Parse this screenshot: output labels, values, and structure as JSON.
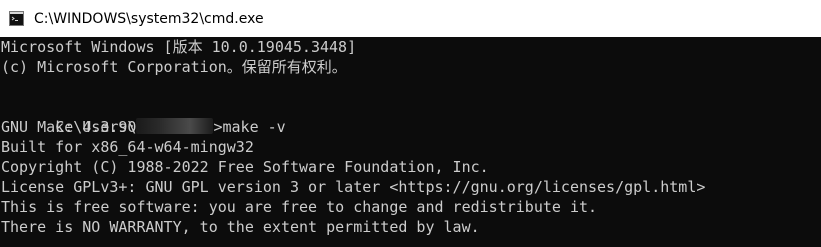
{
  "window": {
    "title": "C:\\WINDOWS\\system32\\cmd.exe"
  },
  "console": {
    "lines": {
      "0": "Microsoft Windows [版本 10.0.19045.3448]",
      "1": "(c) Microsoft Corporation。保留所有权利。",
      "2": "",
      "3": {
        "prefix": "C:\\Users\\",
        "suffix": ">make -v"
      },
      "4": "GNU Make 4.3.90",
      "5": "Built for x86_64-w64-mingw32",
      "6": "Copyright (C) 1988-2022 Free Software Foundation, Inc.",
      "7": "License GPLv3+: GNU GPL version 3 or later <https://gnu.org/licenses/gpl.html>",
      "8": "This is free software: you are free to change and redistribute it.",
      "9": "There is NO WARRANTY, to the extent permitted by law."
    }
  },
  "colors": {
    "console_bg": "#0c0c0c",
    "console_text": "#cccccc",
    "titlebar_bg": "#ffffff"
  }
}
